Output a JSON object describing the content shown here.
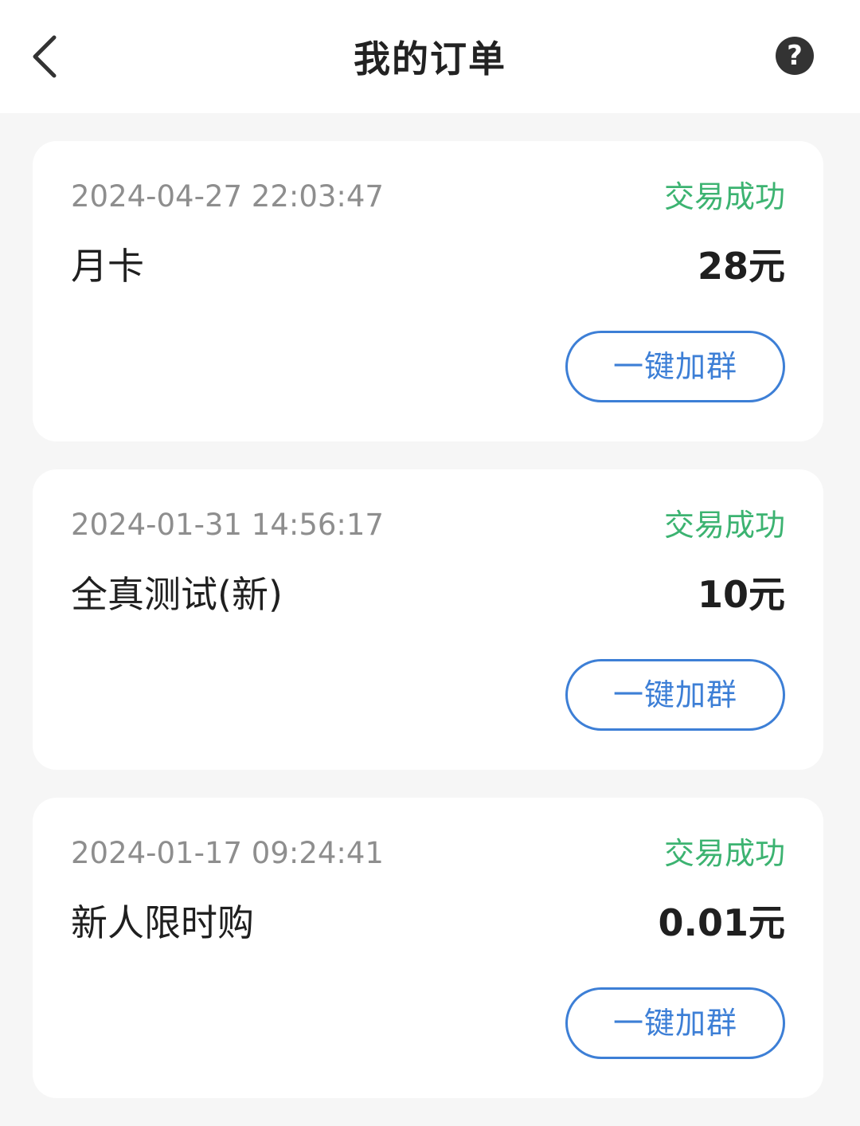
{
  "header": {
    "title": "我的订单",
    "back_icon": "chevron-left-icon",
    "help_icon": "question-circle-icon",
    "help_glyph": "?"
  },
  "orders": [
    {
      "time": "2024-04-27 22:03:47",
      "status": "交易成功",
      "name": "月卡",
      "price": "28元",
      "button_label": "一键加群"
    },
    {
      "time": "2024-01-31 14:56:17",
      "status": "交易成功",
      "name": "全真测试(新)",
      "price": "10元",
      "button_label": "一键加群"
    },
    {
      "time": "2024-01-17 09:24:41",
      "status": "交易成功",
      "name": "新人限时购",
      "price": "0.01元",
      "button_label": "一键加群"
    }
  ],
  "colors": {
    "status_success": "#3cb371",
    "accent_blue": "#3d7fd6",
    "background": "#f6f6f6"
  }
}
